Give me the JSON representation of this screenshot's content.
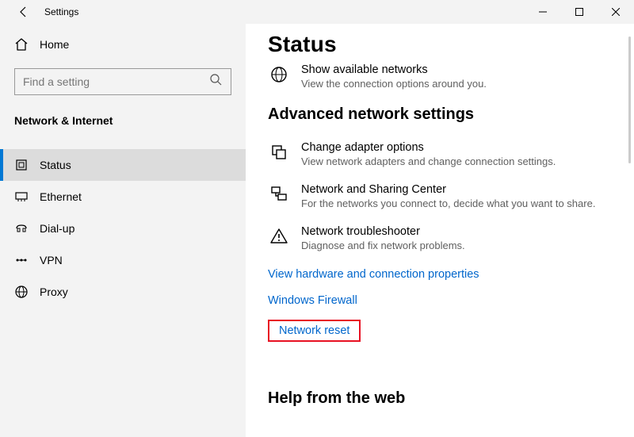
{
  "titlebar": {
    "title": "Settings"
  },
  "sidebar": {
    "home_label": "Home",
    "search_placeholder": "Find a setting",
    "category": "Network & Internet",
    "items": [
      {
        "label": "Status"
      },
      {
        "label": "Ethernet"
      },
      {
        "label": "Dial-up"
      },
      {
        "label": "VPN"
      },
      {
        "label": "Proxy"
      }
    ]
  },
  "main": {
    "title": "Status",
    "show_networks": {
      "title": "Show available networks",
      "subtitle": "View the connection options around you."
    },
    "advanced_heading": "Advanced network settings",
    "adapter": {
      "title": "Change adapter options",
      "subtitle": "View network adapters and change connection settings."
    },
    "sharing": {
      "title": "Network and Sharing Center",
      "subtitle": "For the networks you connect to, decide what you want to share."
    },
    "trouble": {
      "title": "Network troubleshooter",
      "subtitle": "Diagnose and fix network problems."
    },
    "link_hardware": "View hardware and connection properties",
    "link_firewall": "Windows Firewall",
    "link_reset": "Network reset",
    "help_heading": "Help from the web"
  }
}
